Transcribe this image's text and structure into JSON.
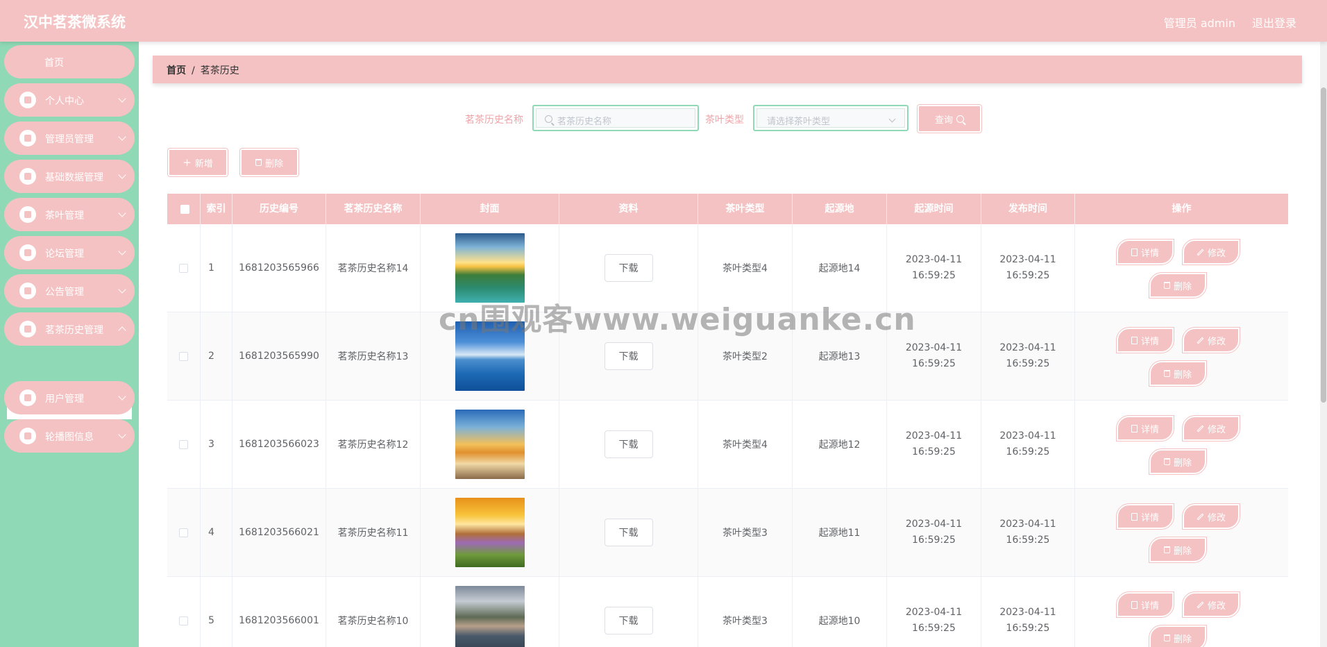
{
  "header": {
    "title": "汉中茗茶微系统",
    "user_label": "管理员 admin",
    "logout_label": "退出登录"
  },
  "sidebar": {
    "items": [
      {
        "label": "首页",
        "icon": "home-icon"
      },
      {
        "label": "个人中心",
        "icon": "user-icon"
      },
      {
        "label": "管理员管理",
        "icon": "chat-icon"
      },
      {
        "label": "基础数据管理",
        "icon": "list-icon"
      },
      {
        "label": "茶叶管理",
        "icon": "clipboard-icon"
      },
      {
        "label": "论坛管理",
        "icon": "grid-icon"
      },
      {
        "label": "公告管理",
        "icon": "grid-icon"
      },
      {
        "label": "茗茶历史管理",
        "icon": "bookmark-icon"
      },
      {
        "label": "用户管理",
        "icon": "location-icon"
      },
      {
        "label": "轮播图信息",
        "icon": "grid-icon"
      }
    ],
    "active_submenu": "茗茶历史管理"
  },
  "breadcrumb": {
    "home": "首页",
    "separator": "/",
    "current": "茗茶历史"
  },
  "search": {
    "name_label": "茗茶历史名称",
    "name_placeholder": "茗茶历史名称",
    "type_label": "茶叶类型",
    "type_placeholder": "请选择茶叶类型",
    "query_label": "查询"
  },
  "actions": {
    "add_label": "新增",
    "delete_label": "删除"
  },
  "table": {
    "columns": [
      "索引",
      "历史编号",
      "茗茶历史名称",
      "封面",
      "资料",
      "茶叶类型",
      "起源地",
      "起源时间",
      "发布时间",
      "操作"
    ],
    "download_label": "下载",
    "detail_label": "详情",
    "edit_label": "修改",
    "remove_label": "删除",
    "rows": [
      {
        "index": "1",
        "code": "1681203565966",
        "name": "茗茶历史名称14",
        "cover": "lake-sunset",
        "type": "茶叶类型4",
        "origin": "起源地14",
        "origin_time": "2023-04-11 16:59:25",
        "publish_time": "2023-04-11 16:59:25"
      },
      {
        "index": "2",
        "code": "1681203565990",
        "name": "茗茶历史名称13",
        "cover": "sea-sky",
        "type": "茶叶类型2",
        "origin": "起源地13",
        "origin_time": "2023-04-11 16:59:25",
        "publish_time": "2023-04-11 16:59:25"
      },
      {
        "index": "3",
        "code": "1681203566023",
        "name": "茗茶历史名称12",
        "cover": "beach-rainbow",
        "type": "茶叶类型4",
        "origin": "起源地12",
        "origin_time": "2023-04-11 16:59:25",
        "publish_time": "2023-04-11 16:59:25"
      },
      {
        "index": "4",
        "code": "1681203566021",
        "name": "茗茶历史名称11",
        "cover": "flower-field",
        "type": "茶叶类型3",
        "origin": "起源地11",
        "origin_time": "2023-04-11 16:59:25",
        "publish_time": "2023-04-11 16:59:25"
      },
      {
        "index": "5",
        "code": "1681203566001",
        "name": "茗茶历史名称10",
        "cover": "mountain-village",
        "type": "茶叶类型3",
        "origin": "起源地10",
        "origin_time": "2023-04-11 16:59:25",
        "publish_time": "2023-04-11 16:59:25"
      }
    ]
  },
  "watermark": "cn围观客www.weiguanke.cn",
  "colors": {
    "header": "#f5c2c3",
    "sidebar": "#8fd9b6",
    "accent_green": "#8fd9b6",
    "label_pink": "#f0a4a8"
  }
}
